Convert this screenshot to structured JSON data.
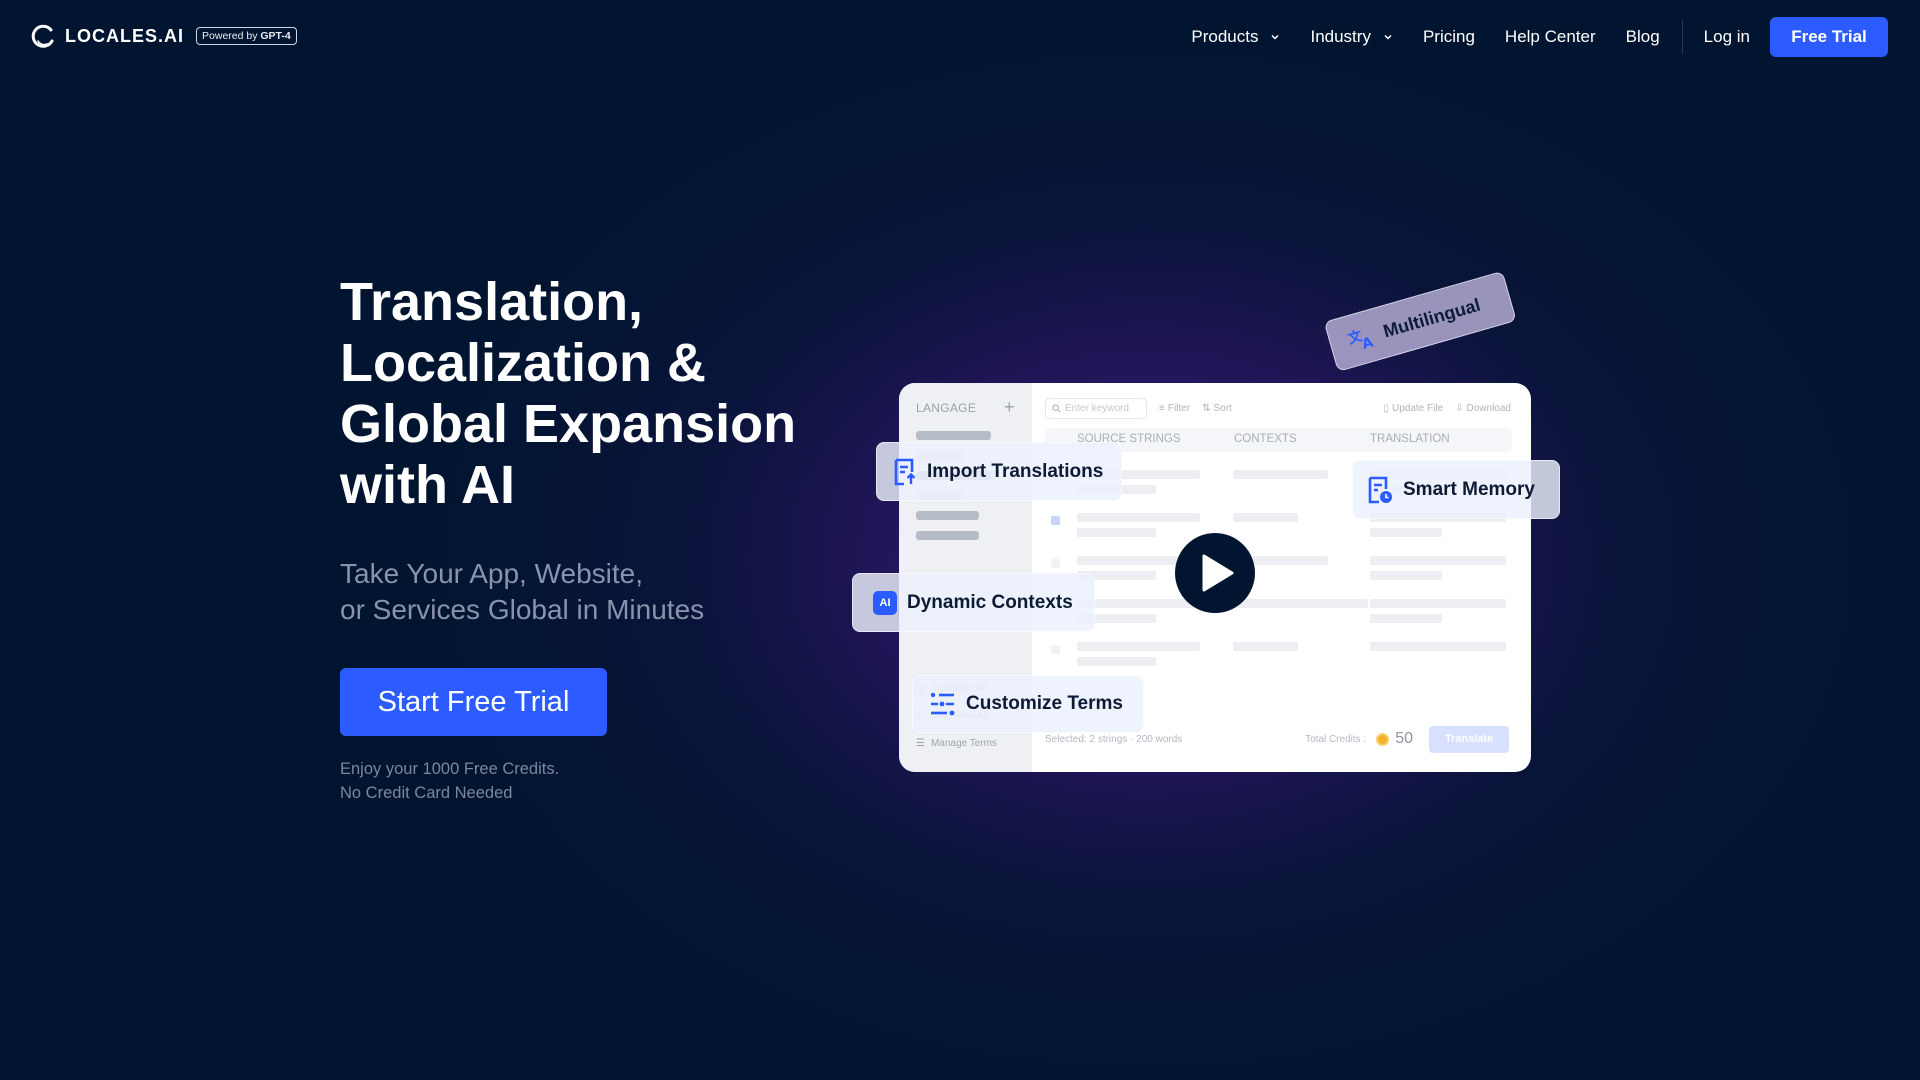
{
  "header": {
    "logo_text": "LOCALES.AI",
    "badge_prefix": "Powered by ",
    "badge_strong": "GPT-4",
    "nav": [
      {
        "label": "Products",
        "has_dropdown": true
      },
      {
        "label": "Industry",
        "has_dropdown": true
      },
      {
        "label": "Pricing",
        "has_dropdown": false
      },
      {
        "label": "Help Center",
        "has_dropdown": false
      },
      {
        "label": "Blog",
        "has_dropdown": false
      }
    ],
    "login_label": "Log in",
    "free_trial_label": "Free Trial"
  },
  "hero": {
    "title_lines": [
      "Translation,",
      "Localization &",
      "Global Expansion",
      "with AI"
    ],
    "subtitle_lines": [
      "Take Your App, Website,",
      "or Services Global in Minutes"
    ],
    "cta_label": "Start Free Trial",
    "note_lines": [
      "Enjoy your 1000 Free Credits.",
      "No Credit Card Needed"
    ]
  },
  "mockup": {
    "sidebar_title": "LANGAGE",
    "add_icon": "plus-icon",
    "search_placeholder": "Enter keyword",
    "filter_label": "Filter",
    "sort_label": "Sort",
    "update_file_label": "Update File",
    "download_label": "Download",
    "columns": [
      "SOURCE STRINGS",
      "CONTEXTS",
      "TRANSLATION"
    ],
    "side_tools": [
      "Translate All",
      "Download All",
      "Manage Terms"
    ],
    "selected_text": "Selected: 2 strings · 200 words",
    "total_credits_label": "Total Credits :",
    "total_credits_value": "50",
    "translate_label": "Translate"
  },
  "features": {
    "import": "Import Translations",
    "memory": "Smart Memory",
    "dynamic": "Dynamic Contexts",
    "dynamic_icon_text": "AI",
    "terms": "Customize Terms",
    "multilingual": "Multilingual"
  },
  "colors": {
    "background": "#011530",
    "accent": "#2c5cff",
    "glow": "#4c1896"
  }
}
